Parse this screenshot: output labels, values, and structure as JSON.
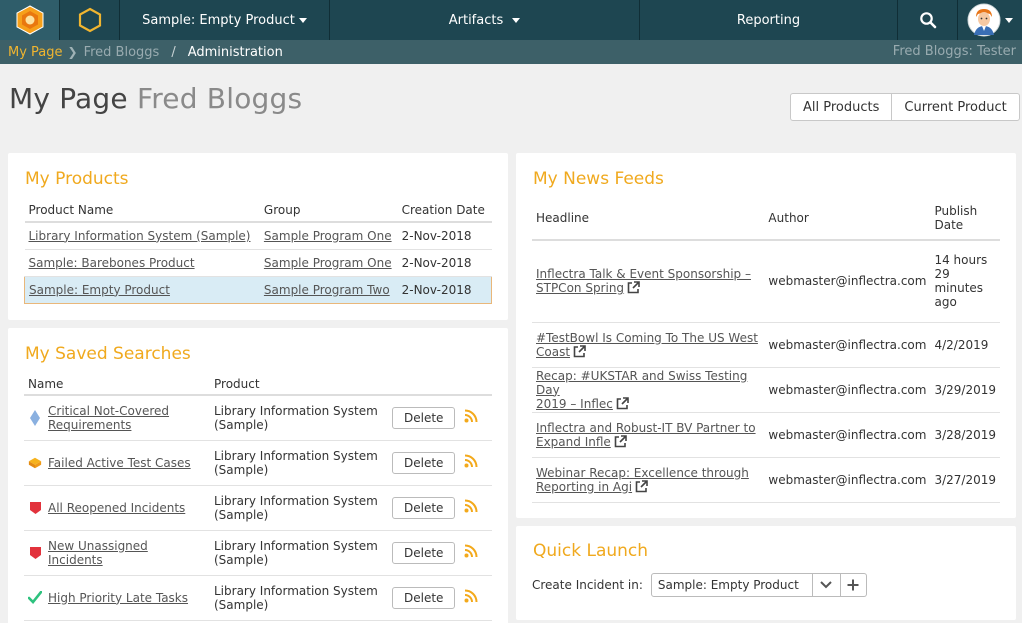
{
  "topnav": {
    "product_label": "Sample: Empty Product",
    "artifacts_label": "Artifacts",
    "reporting_label": "Reporting"
  },
  "breadcrumb": {
    "my_page": "My Page",
    "user": "Fred Bloggs",
    "separator": "/",
    "admin": "Administration",
    "right": "Fred Bloggs: Tester"
  },
  "page": {
    "title": "My Page",
    "subtitle": "Fred Bloggs"
  },
  "scope_toggle": {
    "all": "All Products",
    "current": "Current Product"
  },
  "my_products": {
    "title": "My Products",
    "columns": [
      "Product Name",
      "Group",
      "Creation Date"
    ],
    "rows": [
      {
        "name": "Library Information System (Sample)",
        "group": "Sample Program One",
        "date": "2-Nov-2018"
      },
      {
        "name": "Sample: Barebones Product",
        "group": "Sample Program One",
        "date": "2-Nov-2018"
      },
      {
        "name": "Sample: Empty Product",
        "group": "Sample Program Two",
        "date": "2-Nov-2018"
      }
    ]
  },
  "saved_searches": {
    "title": "My Saved Searches",
    "columns": [
      "Name",
      "Product"
    ],
    "delete_label": "Delete",
    "rows": [
      {
        "name_l1": "Critical Not-Covered",
        "name_l2": "Requirements",
        "prod_l1": "Library Information System",
        "prod_l2": "(Sample)",
        "icon": "requirement-diamond-icon"
      },
      {
        "name_l1": "Failed Active Test Cases",
        "name_l2": "",
        "prod_l1": "Library Information System",
        "prod_l2": "(Sample)",
        "icon": "test-case-icon"
      },
      {
        "name_l1": "All Reopened Incidents",
        "name_l2": "",
        "prod_l1": "Library Information System",
        "prod_l2": "(Sample)",
        "icon": "incident-icon"
      },
      {
        "name_l1": "New Unassigned Incidents",
        "name_l2": "",
        "prod_l1": "Library Information System",
        "prod_l2": "(Sample)",
        "icon": "incident-icon"
      },
      {
        "name_l1": "High Priority Late Tasks",
        "name_l2": "",
        "prod_l1": "Library Information System",
        "prod_l2": "(Sample)",
        "icon": "task-check-icon"
      }
    ]
  },
  "news_feeds": {
    "title": "My News Feeds",
    "col_headline": "Headline",
    "col_author": "Author",
    "col_date_l1": "Publish",
    "col_date_l2": "Date",
    "rows": [
      {
        "l1": "Inflectra Talk & Event Sponsorship –",
        "l2": "STPCon Spring",
        "author": "webmaster@inflectra.com",
        "d1": "14 hours",
        "d2": "29",
        "d3": "minutes",
        "d4": "ago"
      },
      {
        "l1": "#TestBowl Is Coming To The US West",
        "l2": "Coast",
        "author": "webmaster@inflectra.com",
        "d1": "4/2/2019",
        "d2": "",
        "d3": "",
        "d4": ""
      },
      {
        "l1": "Recap: #UKSTAR and Swiss Testing Day",
        "l2": "2019 – Inflec",
        "author": "webmaster@inflectra.com",
        "d1": "3/29/2019",
        "d2": "",
        "d3": "",
        "d4": ""
      },
      {
        "l1": "Inflectra and Robust-IT BV Partner to",
        "l2": "Expand Infle",
        "author": "webmaster@inflectra.com",
        "d1": "3/28/2019",
        "d2": "",
        "d3": "",
        "d4": ""
      },
      {
        "l1": "Webinar Recap: Excellence through",
        "l2": "Reporting in Agi",
        "author": "webmaster@inflectra.com",
        "d1": "3/27/2019",
        "d2": "",
        "d3": "",
        "d4": ""
      }
    ]
  },
  "quick_launch": {
    "title": "Quick Launch",
    "label": "Create Incident in:",
    "selected": "Sample: Empty Product"
  },
  "colors": {
    "nav_bg": "#1e4651",
    "crumb_bg": "#3d6068",
    "accent_orange": "#f0a91e",
    "selection_bg": "#d9ecf5"
  }
}
